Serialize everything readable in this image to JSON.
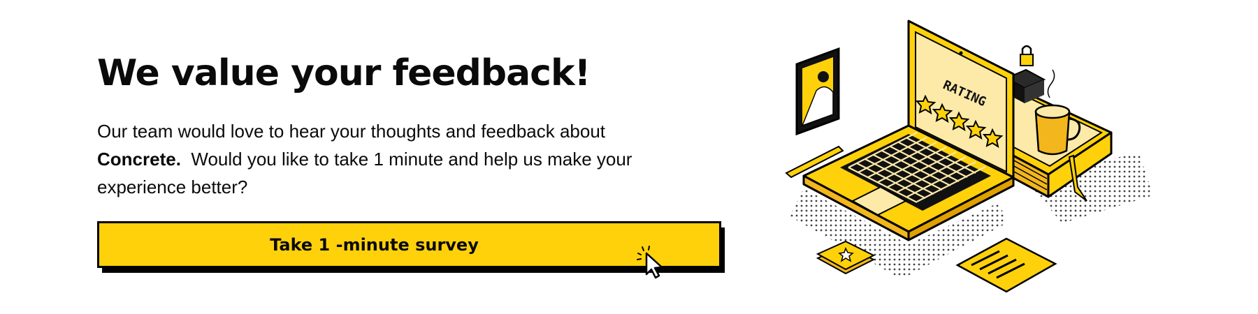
{
  "headline": "We value your feedback!",
  "body": {
    "line1": "Our team would love to hear your thoughts and feedback about",
    "product": "Concrete.",
    "line2": "  Would you like to take 1 minute and help us make your",
    "line3": "experience better?"
  },
  "cta": {
    "label": "Take 1 -minute survey"
  },
  "illustration": {
    "screen_text": "RATING",
    "stars": 5,
    "icons": [
      "laptop-icon",
      "picture-frame-icon",
      "pen-icon",
      "padlock-icon",
      "coffee-cup-icon",
      "sticky-note-icon",
      "document-icon",
      "cursor-icon"
    ]
  },
  "colors": {
    "accent": "#ffd10b",
    "text": "#0a0a0a",
    "background": "#ffffff"
  }
}
